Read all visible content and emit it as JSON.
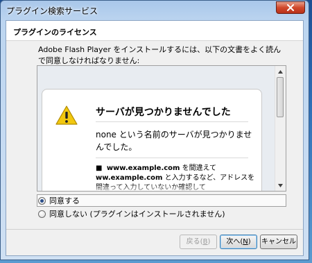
{
  "window": {
    "title": "プラグイン検索サービス"
  },
  "header": {
    "title": "プラグインのライセンス"
  },
  "instruction": "Adobe Flash Player をインストールするには、以下の文書をよく読んで同意しなければなりません:",
  "license": {
    "error_title": "サーバが見つかりませんでした",
    "error_message": "none という名前のサーバが見つかりませんでした。",
    "bullet_bold1": "www.example.com",
    "bullet_text1": " を間違えて",
    "bullet_bold2": "ww.example.com",
    "bullet_text2": " と入力するなど、アドレスを間違って入力していないか確認して"
  },
  "options": {
    "agree": "同意する",
    "disagree": "同意しない (プラグインはインストールされません)"
  },
  "buttons": {
    "back_label": "戻る(",
    "back_key": "B",
    "back_end": ")",
    "next_label": "次へ(",
    "next_key": "N",
    "next_end": ")",
    "cancel_label": "キャンセル"
  },
  "colors": {
    "close_button": "#d0482c",
    "titlebar": "#bcd5f0",
    "warning_yellow": "#f2c80f"
  },
  "icons": {
    "close": "close-icon",
    "warning": "warning-icon",
    "scroll_up": "chevron-up-icon",
    "scroll_down": "chevron-down-icon"
  }
}
